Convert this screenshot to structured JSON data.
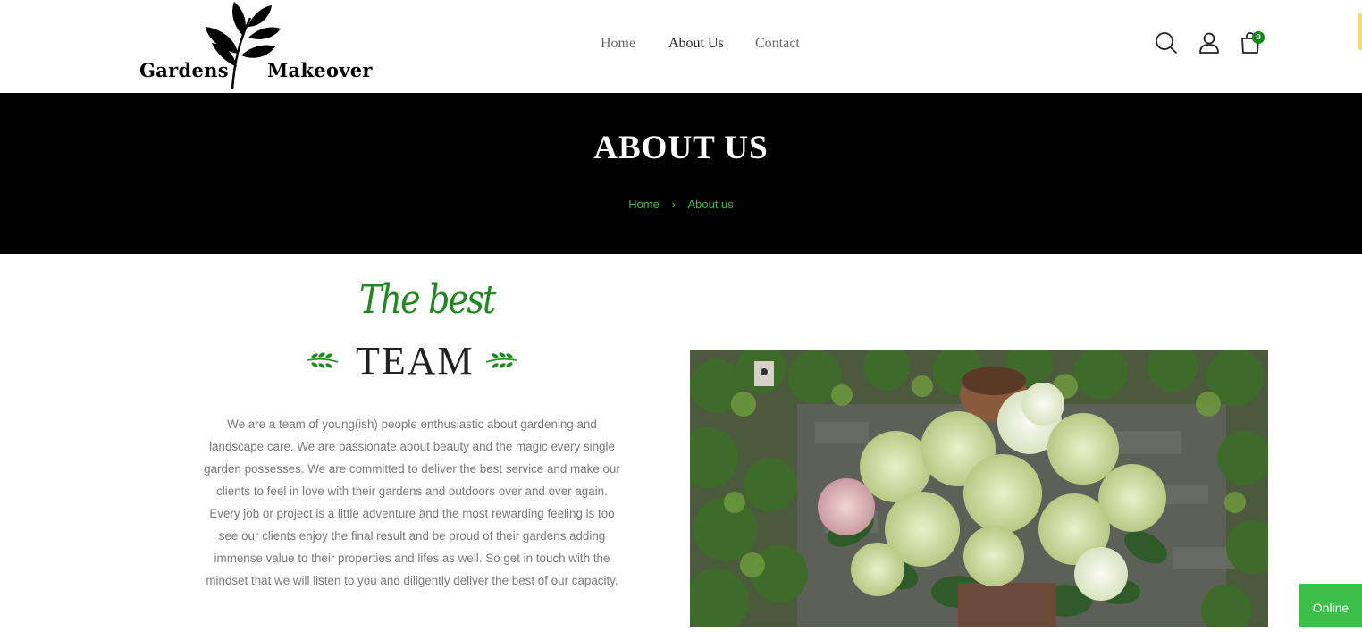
{
  "header": {
    "logo": {
      "word_left": "Gardens",
      "word_right": "Makeover"
    },
    "nav": [
      {
        "label": "Home",
        "active": false
      },
      {
        "label": "About Us",
        "active": true
      },
      {
        "label": "Contact",
        "active": false
      }
    ],
    "icons": [
      "search-icon",
      "user-icon",
      "cart-icon"
    ],
    "cart_count": "0"
  },
  "banner": {
    "title": "ABOUT US",
    "breadcrumb": {
      "home": "Home",
      "separator": "›",
      "current": "About us"
    }
  },
  "about": {
    "script_heading": "The best",
    "heading": "TEAM",
    "body": "We are a team of young(ish) people enthusiastic about gardening and landscape care. We are passionate about beauty and the magic every single garden possesses. We are committed to deliver the best service and make our clients to feel in love with their gardens and outdoors over and over again. Every job or project is a little adventure and the most rewarding feeling is too see our clients enjoy the final result and be proud of their gardens adding immense value to their properties and lifes as well. So get in touch with the mindset that we will listen to you and diligently deliver the best of our capacity."
  },
  "chat": {
    "status": "Online"
  },
  "colors": {
    "accent": "#1e8a1e",
    "banner_bg": "#000000",
    "badge": "#0e8a16",
    "chat": "#3bbf4a"
  }
}
